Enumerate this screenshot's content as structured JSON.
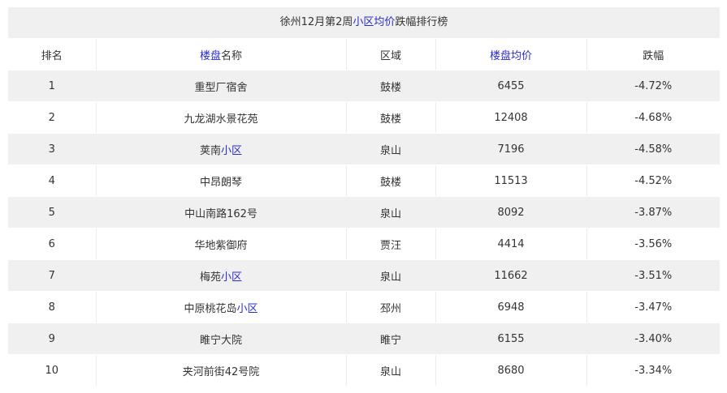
{
  "title": {
    "prefix": "徐州12月第2周",
    "link": "小区均价",
    "suffix": "跌幅排行榜"
  },
  "headers": {
    "rank": "排名",
    "name_link": "楼盘",
    "name_rest": "名称",
    "district": "区域",
    "price": "楼盘均价",
    "change": "跌幅"
  },
  "rows": [
    {
      "rank": "1",
      "name": "重型厂宿舍",
      "name_link": "",
      "district": "鼓楼",
      "price": "6455",
      "change": "-4.72%"
    },
    {
      "rank": "2",
      "name": "九龙湖水景花苑",
      "name_link": "",
      "district": "鼓楼",
      "price": "12408",
      "change": "-4.68%"
    },
    {
      "rank": "3",
      "name": "荚南",
      "name_link": "小区",
      "district": "泉山",
      "price": "7196",
      "change": "-4.58%"
    },
    {
      "rank": "4",
      "name": "中昂朗琴",
      "name_link": "",
      "district": "鼓楼",
      "price": "11513",
      "change": "-4.52%"
    },
    {
      "rank": "5",
      "name": "中山南路162号",
      "name_link": "",
      "district": "泉山",
      "price": "8092",
      "change": "-3.87%"
    },
    {
      "rank": "6",
      "name": "华地紫御府",
      "name_link": "",
      "district": "贾汪",
      "price": "4414",
      "change": "-3.56%"
    },
    {
      "rank": "7",
      "name": "梅苑",
      "name_link": "小区",
      "district": "泉山",
      "price": "11662",
      "change": "-3.51%"
    },
    {
      "rank": "8",
      "name": "中原桃花岛",
      "name_link": "小区",
      "district": "邳州",
      "price": "6948",
      "change": "-3.47%"
    },
    {
      "rank": "9",
      "name": "睢宁大院",
      "name_link": "",
      "district": "睢宁",
      "price": "6155",
      "change": "-3.40%"
    },
    {
      "rank": "10",
      "name": "夹河前街42号院",
      "name_link": "",
      "district": "泉山",
      "price": "8680",
      "change": "-3.34%"
    }
  ]
}
